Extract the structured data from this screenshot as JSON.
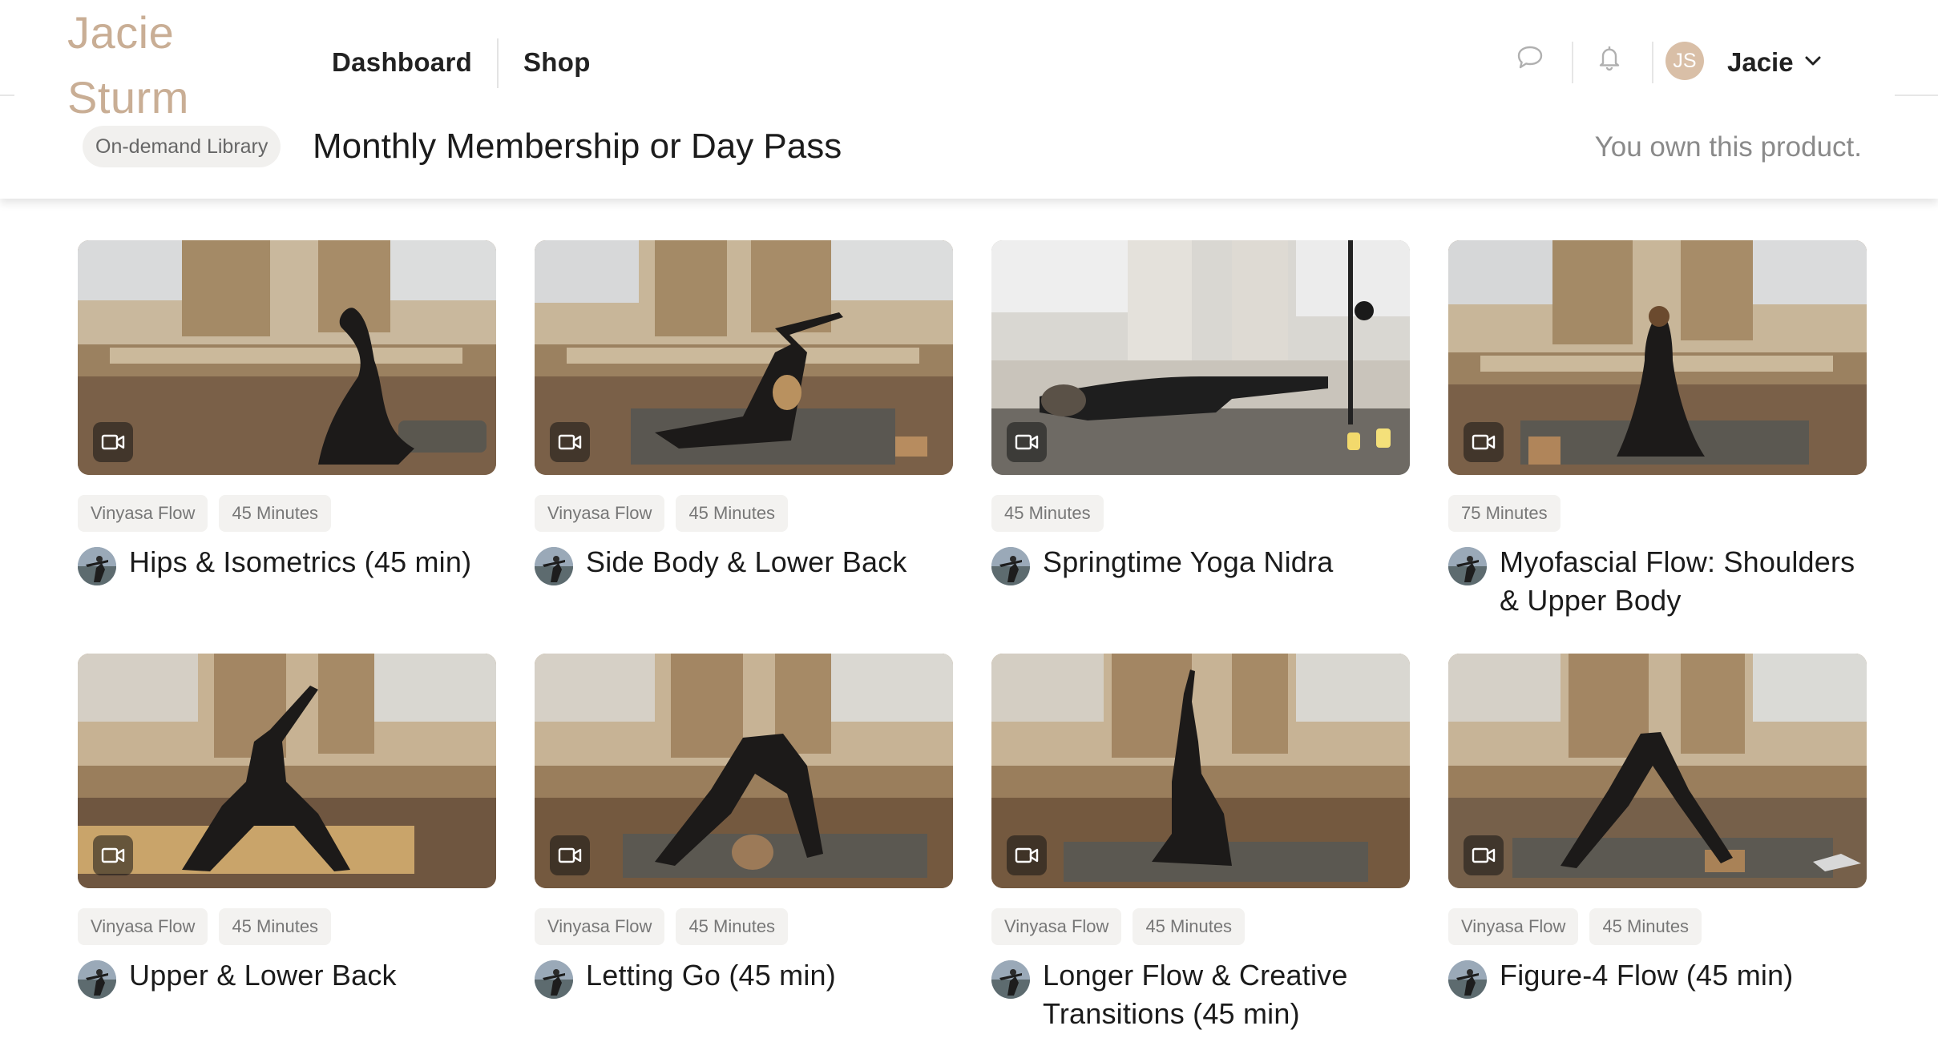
{
  "brand": {
    "line1": "Jacie",
    "line2": "Sturm"
  },
  "nav": {
    "dashboard": "Dashboard",
    "shop": "Shop"
  },
  "header_icons": {
    "chat": "chat-bubble-icon",
    "notifications": "bell-icon"
  },
  "user": {
    "initials": "JS",
    "name": "Jacie"
  },
  "product": {
    "badge": "On-demand Library",
    "title": "Monthly Membership or Day Pass",
    "status": "You own this product."
  },
  "colors": {
    "brand": "#c9ae95",
    "avatar": "#d9bfa7",
    "tag_bg": "#f3f2f0"
  },
  "videos": [
    {
      "title": "Hips & Isometrics (45 min)",
      "tags": [
        "Vinyasa Flow",
        "45 Minutes"
      ]
    },
    {
      "title": "Side Body & Lower Back",
      "tags": [
        "Vinyasa Flow",
        "45 Minutes"
      ]
    },
    {
      "title": "Springtime Yoga Nidra",
      "tags": [
        "45 Minutes"
      ]
    },
    {
      "title": "Myofascial Flow: Shoulders & Upper Body",
      "tags": [
        "75 Minutes"
      ]
    },
    {
      "title": "Upper & Lower Back",
      "tags": [
        "Vinyasa Flow",
        "45 Minutes"
      ]
    },
    {
      "title": "Letting Go (45 min)",
      "tags": [
        "Vinyasa Flow",
        "45 Minutes"
      ]
    },
    {
      "title": "Longer Flow & Creative Transitions (45 min)",
      "tags": [
        "Vinyasa Flow",
        "45 Minutes"
      ]
    },
    {
      "title": "Figure-4 Flow (45 min)",
      "tags": [
        "Vinyasa Flow",
        "45 Minutes"
      ]
    }
  ]
}
